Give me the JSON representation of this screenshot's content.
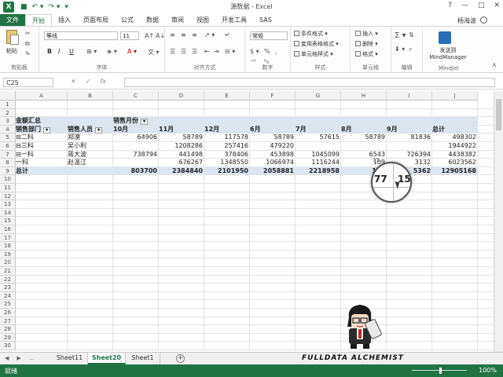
{
  "window": {
    "title": "源数据 - Excel",
    "user": "杨海波"
  },
  "quick_access": {
    "save_icon": "save-icon",
    "undo_icon": "undo-icon",
    "redo_icon": "redo-icon"
  },
  "window_controls": [
    "?",
    "—",
    "□",
    "✕"
  ],
  "tabs": [
    {
      "label": "文件"
    },
    {
      "label": "开始"
    },
    {
      "label": "插入"
    },
    {
      "label": "页面布局"
    },
    {
      "label": "公式"
    },
    {
      "label": "数据"
    },
    {
      "label": "审阅"
    },
    {
      "label": "视图"
    },
    {
      "label": "开发工具"
    },
    {
      "label": "SAS"
    }
  ],
  "ribbon": {
    "clipboard": {
      "label": "剪贴板",
      "paste": "粘贴"
    },
    "font": {
      "label": "字体",
      "name": "等线",
      "size": "11",
      "bold": "B",
      "italic": "I",
      "underline": "U"
    },
    "alignment": {
      "label": "对齐方式"
    },
    "number": {
      "label": "数字",
      "format": "常规"
    },
    "styles": {
      "label": "样式",
      "items": [
        "条件格式 ▾",
        "套用表格格式 ▾",
        "单元格样式 ▾"
      ]
    },
    "cells": {
      "label": "单元格",
      "items": [
        "插入 ▾",
        "删除 ▾",
        "格式 ▾"
      ]
    },
    "editing": {
      "label": "编辑"
    },
    "mindjet": {
      "label": "Mindjet",
      "button": "发送到 MindManager"
    }
  },
  "formula_bar": {
    "name_box": "C25",
    "cancel": "✕",
    "enter": "✓",
    "fx": "fx",
    "value": ""
  },
  "columns": [
    "A",
    "B",
    "C",
    "D",
    "E",
    "F",
    "G",
    "H",
    "I",
    "J"
  ],
  "rows": [
    "1",
    "2",
    "3",
    "4",
    "5",
    "6",
    "7",
    "8",
    "9",
    "10",
    "11",
    "12",
    "13",
    "14",
    "15",
    "16",
    "17",
    "18",
    "19",
    "20",
    "21",
    "22",
    "23",
    "24",
    "25",
    "26",
    "27",
    "28",
    "29",
    "30",
    "31"
  ],
  "pivot": {
    "title": "金额汇总",
    "col_field": "销售月份",
    "row_field_1": "销售部门",
    "row_field_2": "销售人员",
    "months": [
      "10月",
      "11月",
      "12月",
      "6月",
      "7月",
      "8月",
      "9月",
      "总计"
    ],
    "body": [
      {
        "dept": "⊟二科",
        "person": "郑漠",
        "values": [
          "64906",
          "58789",
          "117578",
          "58789",
          "57615",
          "58789",
          "81836",
          "498302"
        ]
      },
      {
        "dept": "⊟三科",
        "person": "吴小利",
        "values": [
          "",
          "1208286",
          "257416",
          "479220",
          "",
          "",
          "",
          "1944922"
        ]
      },
      {
        "dept": "⊟一科",
        "person": "蒋大波",
        "values": [
          "738794",
          "441498",
          "378406",
          "453898",
          "1045099",
          "6543",
          "726394",
          "4438382"
        ]
      },
      {
        "dept": "一科",
        "person": "赵温江",
        "values": [
          "",
          "676267",
          "1348550",
          "1066974",
          "1116244",
          "109",
          "3132",
          "6023562"
        ]
      }
    ],
    "total": {
      "label": "总计",
      "values": [
        "803700",
        "2384840",
        "2101950",
        "2058881",
        "2218958",
        "180",
        "5362",
        "12905168"
      ]
    }
  },
  "magnifier": {
    "left_text": "77",
    "right_text": "15",
    "top_text": "35"
  },
  "sheets": {
    "nav": [
      "◀",
      "▶",
      "..."
    ],
    "tabs": [
      "Sheet11",
      "Sheet20",
      "Sheet1"
    ],
    "active": "Sheet20",
    "add": "+"
  },
  "watermark": "FULLDATA ALCHEMIST",
  "status": {
    "ready": "就绪",
    "zoom": "100%"
  }
}
